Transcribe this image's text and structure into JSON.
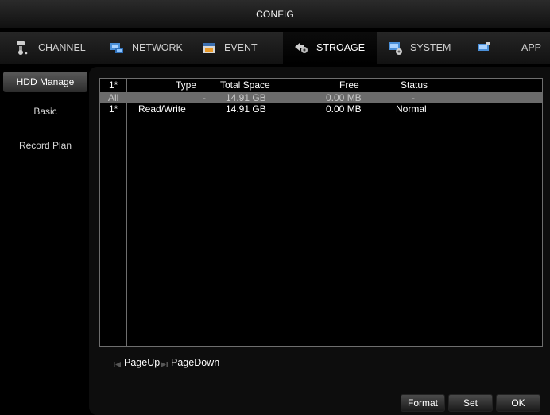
{
  "window": {
    "title": "CONFIG"
  },
  "tabs": [
    {
      "label": "CHANNEL",
      "icon": "channel-icon",
      "active": false
    },
    {
      "label": "NETWORK",
      "icon": "network-icon",
      "active": false
    },
    {
      "label": "EVENT",
      "icon": "event-icon",
      "active": false
    },
    {
      "label": "STROAGE",
      "icon": "storage-icon",
      "active": true
    },
    {
      "label": "SYSTEM",
      "icon": "system-icon",
      "active": false
    },
    {
      "label": "APP",
      "icon": "app-icon",
      "active": false
    }
  ],
  "sidebar": {
    "items": [
      {
        "label": "HDD Manage",
        "active": true
      },
      {
        "label": "Basic",
        "active": false
      },
      {
        "label": "Record Plan",
        "active": false
      }
    ]
  },
  "hdd_table": {
    "columns": [
      "1*",
      "Type",
      "Total Space",
      "Free",
      "Status"
    ],
    "rows": [
      {
        "id": "All",
        "type": "-",
        "total": "14.91 GB",
        "free": "0.00 MB",
        "status": "-"
      },
      {
        "id": "1*",
        "type": "Read/Write",
        "total": "14.91 GB",
        "free": "0.00 MB",
        "status": "Normal"
      }
    ]
  },
  "pager": {
    "page_up": "PageUp",
    "page_down": "PageDown"
  },
  "buttons": {
    "format": "Format",
    "set": "Set",
    "ok": "OK"
  },
  "colors": {
    "selected_row": "#6b6b6b",
    "active_sidebar": "#4a4a4a",
    "panel_bg": "#0d0d0d"
  }
}
